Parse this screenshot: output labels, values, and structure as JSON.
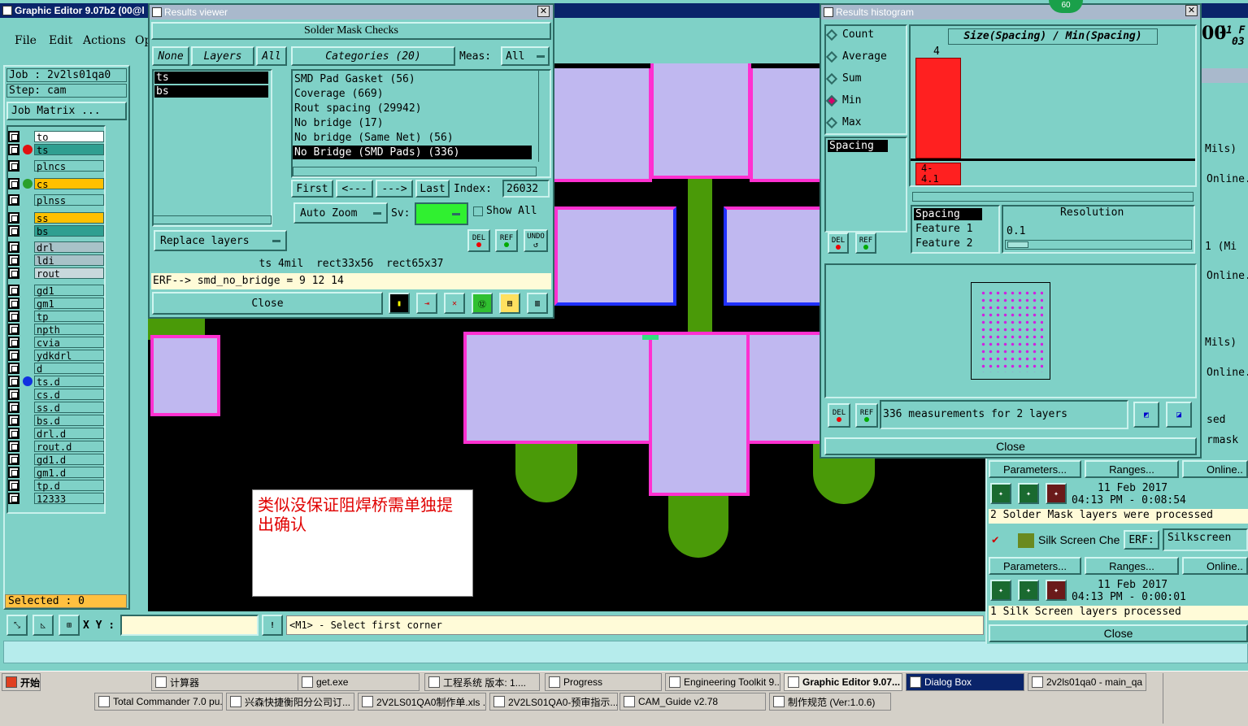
{
  "main_window": {
    "title": "Graphic Editor 9.07b2 (00@l",
    "menu": [
      "File",
      "Edit",
      "Actions",
      "Op"
    ],
    "job_label": "Job : 2v2ls01qa0",
    "step_label": "Step: cam",
    "job_matrix": "Job Matrix ...",
    "layers": [
      {
        "name": "to",
        "color": "#ffffff",
        "dot": ""
      },
      {
        "name": "ts",
        "color": "#2f9f91",
        "dot": "#e01010",
        "active": true
      },
      {
        "name": "plncs",
        "color": "#7fd1c7",
        "dot": ""
      },
      {
        "name": "cs",
        "color": "#ffc000",
        "dot": "#2aa02a"
      },
      {
        "name": "plnss",
        "color": "#7fd1c7",
        "dot": ""
      },
      {
        "name": "ss",
        "color": "#ffc000",
        "dot": ""
      },
      {
        "name": "bs",
        "color": "#2f9f91",
        "dot": ""
      },
      {
        "name": "drl",
        "color": "#a8c2c8",
        "dot": ""
      },
      {
        "name": "ldi",
        "color": "#a8c2c8",
        "dot": ""
      },
      {
        "name": "rout",
        "color": "#c8d8dc",
        "dot": ""
      },
      {
        "name": "gd1",
        "color": "#7fd1c7",
        "dot": ""
      },
      {
        "name": "gm1",
        "color": "#7fd1c7",
        "dot": ""
      },
      {
        "name": "tp",
        "color": "#7fd1c7",
        "dot": ""
      },
      {
        "name": "npth",
        "color": "#7fd1c7",
        "dot": ""
      },
      {
        "name": "cvia",
        "color": "#7fd1c7",
        "dot": ""
      },
      {
        "name": "ydkdrl",
        "color": "#7fd1c7",
        "dot": ""
      },
      {
        "name": "d",
        "color": "#7fd1c7",
        "dot": ""
      },
      {
        "name": "ts.d",
        "color": "#7fd1c7",
        "dot": "#1030e0"
      },
      {
        "name": "cs.d",
        "color": "#7fd1c7",
        "dot": ""
      },
      {
        "name": "ss.d",
        "color": "#7fd1c7",
        "dot": ""
      },
      {
        "name": "bs.d",
        "color": "#7fd1c7",
        "dot": ""
      },
      {
        "name": "drl.d",
        "color": "#7fd1c7",
        "dot": ""
      },
      {
        "name": "rout.d",
        "color": "#7fd1c7",
        "dot": ""
      },
      {
        "name": "gd1.d",
        "color": "#7fd1c7",
        "dot": ""
      },
      {
        "name": "gm1.d",
        "color": "#7fd1c7",
        "dot": ""
      },
      {
        "name": "tp.d",
        "color": "#7fd1c7",
        "dot": ""
      },
      {
        "name": "12333",
        "color": "#7fd1c7",
        "dot": ""
      }
    ],
    "selected": "Selected : 0",
    "xy_label": "X Y :",
    "xy_value": "",
    "status_msg": "<M1> - Select first corner",
    "note_text": "类似没保证阻焊桥需单独提出确认",
    "clock_partial": "00",
    "date_partial": "11 F",
    "date_partial2": "03"
  },
  "results_viewer": {
    "title": "Results viewer",
    "header": "Solder Mask Checks",
    "none_btn": "None",
    "layers_btn": "Layers",
    "all_btn": "All",
    "categories_btn": "Categories (20)",
    "meas_label": "Meas:",
    "meas_value": "All",
    "layer_list": [
      "ts",
      "bs"
    ],
    "categories": [
      "SMD Pad Gasket (56)",
      "Coverage (669)",
      "Rout spacing (29942)",
      "No bridge (17)",
      "No bridge (Same Net) (56)",
      "No Bridge (SMD Pads) (336)"
    ],
    "first_btn": "First",
    "prev_btn": "<---",
    "next_btn": "--->",
    "last_btn": "Last",
    "index_label": "Index:",
    "index_value": "26032",
    "auto_zoom": "Auto Zoom",
    "sv_label": "Sv:",
    "show_all": "Show All",
    "replace_layers": "Replace layers",
    "del": "DEL",
    "ref": "REF",
    "undo": "UNDO",
    "info_line": "ts 4mil  rect33x56  rect65x37",
    "erf_line": "ERF--> smd_no_bridge = 9 12 14",
    "close": "Close"
  },
  "histogram": {
    "title": "Results histogram",
    "options": [
      {
        "label": "Count",
        "on": false
      },
      {
        "label": "Average",
        "on": false
      },
      {
        "label": "Sum",
        "on": false
      },
      {
        "label": "Min",
        "on": true
      },
      {
        "label": "Max",
        "on": false
      }
    ],
    "chart_title": "Size(Spacing) / Min(Spacing)",
    "bar_value": "4",
    "bar_range": "4-\n4.1",
    "list_item": "Spacing",
    "sel_items": [
      "Spacing",
      "Feature 1",
      "Feature 2"
    ],
    "resolution_label": "Resolution",
    "resolution_value": "0.1",
    "measurements": "336 measurements for 2 layers",
    "close": "Close",
    "badge": "60"
  },
  "right_panel": {
    "units1": "Mils)",
    "online1": "Online..",
    "mi": "1 (Mi",
    "online2": "Online..",
    "units2": "Mils)",
    "online3": "Online..",
    "sed": "sed",
    "rmask": "rmask",
    "parameters": "Parameters...",
    "ranges": "Ranges...",
    "online": "Online..",
    "date1": "11 Feb 2017",
    "time1": "04:13 PM - 0:08:54",
    "msg1": "2 Solder Mask layers were processed",
    "silk_label": "Silk Screen Che",
    "erf_label": "ERF:",
    "erf_value": "Silkscreen",
    "date2": "11 Feb 2017",
    "time2": "04:13 PM - 0:00:01",
    "msg2": "1 Silk Screen layers processed",
    "close": "Close"
  },
  "taskbar": {
    "start": "开始",
    "row1": [
      "计算器",
      "get.exe",
      "工程系统  版本: 1....",
      "Progress",
      "Engineering Toolkit 9....",
      "Graphic Editor 9.07...",
      "Dialog Box",
      "2v2ls01qa0 - main_qa"
    ],
    "row2": [
      "Total Commander 7.0 pu...",
      "兴森快捷衡阳分公司订...",
      "2V2LS01QA0制作单.xls ...",
      "2V2LS01QA0-预审指示....",
      "CAM_Guide v2.78",
      "制作规范 (Ver:1.0.6)"
    ]
  }
}
